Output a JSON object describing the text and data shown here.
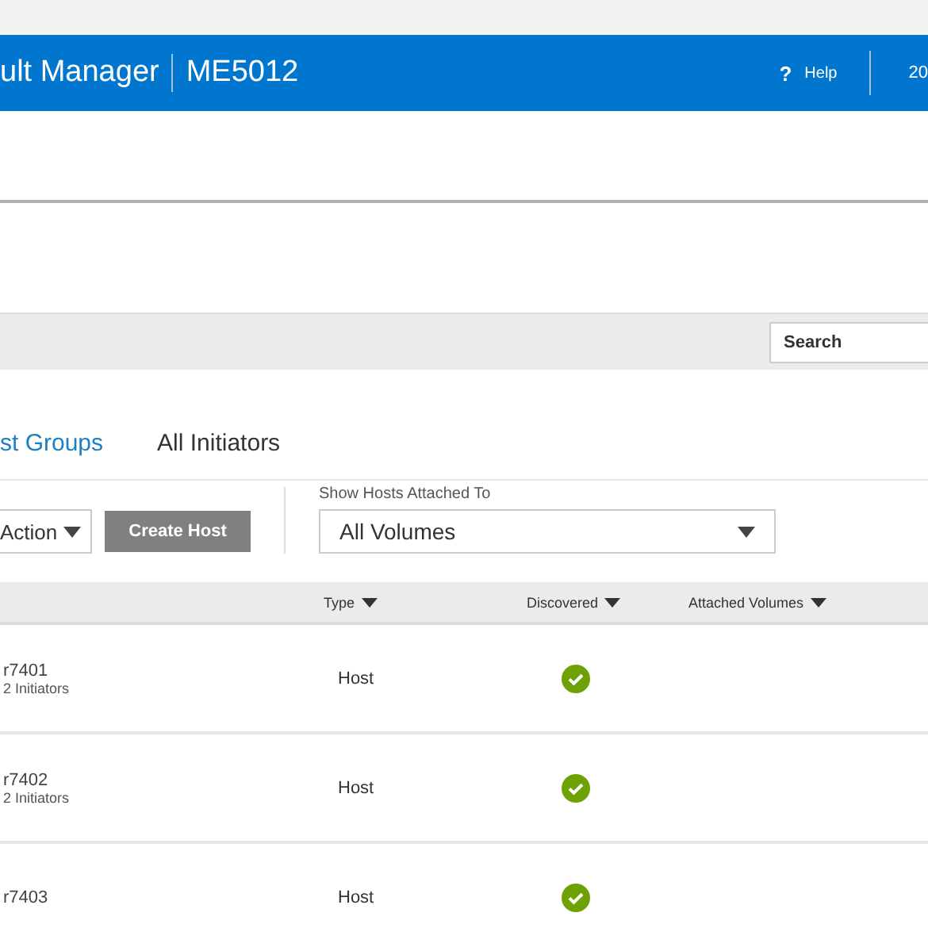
{
  "header": {
    "title": "ult Manager",
    "system": "ME5012",
    "help": "Help",
    "help_icon": "?",
    "user": "20"
  },
  "search": {
    "placeholder": "Search"
  },
  "tabs": [
    {
      "label": "st Groups",
      "selected": true
    },
    {
      "label": "All Initiators",
      "selected": false
    }
  ],
  "toolbar": {
    "action": "Action",
    "create_button": "Create Host",
    "filter_label": "Show Hosts Attached To",
    "filter_value": "All Volumes"
  },
  "table": {
    "columns": [
      "Type",
      "Discovered",
      "Attached Volumes"
    ],
    "rows": [
      {
        "name": "r7401",
        "sub": "2 Initiators",
        "type": "Host",
        "discovered": true
      },
      {
        "name": "r7402",
        "sub": "2 Initiators",
        "type": "Host",
        "discovered": true
      },
      {
        "name": "r7403",
        "type": "Host",
        "discovered": true
      }
    ]
  }
}
